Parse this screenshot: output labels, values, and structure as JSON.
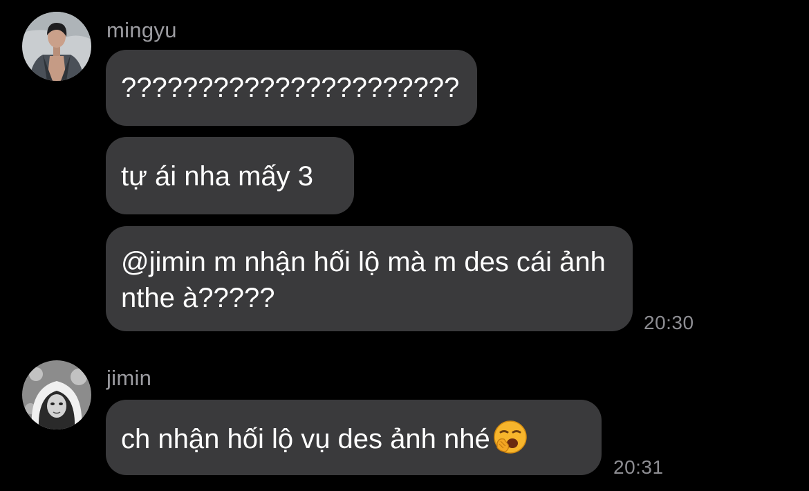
{
  "messages": [
    {
      "sender": "mingyu",
      "avatar_icon": "person-photo-avatar",
      "bubbles": [
        {
          "text": "??????????????????????"
        },
        {
          "text": "tự ái nha mấy 3"
        },
        {
          "text": "@jimin m nhận hối lộ mà m des cái ảnh nthe à?????"
        }
      ],
      "time": "20:30"
    },
    {
      "sender": "jimin",
      "avatar_icon": "person-photo-avatar",
      "bubbles": [
        {
          "text": "ch nhận hối lộ vụ des ảnh nhé",
          "emoji_icon": "yawning-face-emoji-icon"
        }
      ],
      "time": "20:31"
    }
  ],
  "colors": {
    "background": "#000000",
    "bubble": "#3a3a3c",
    "bubble_text": "#ffffff",
    "sender_name": "#9c9ca1",
    "timestamp": "#8e8e93",
    "emoji_yellow": "#f7b52c"
  }
}
